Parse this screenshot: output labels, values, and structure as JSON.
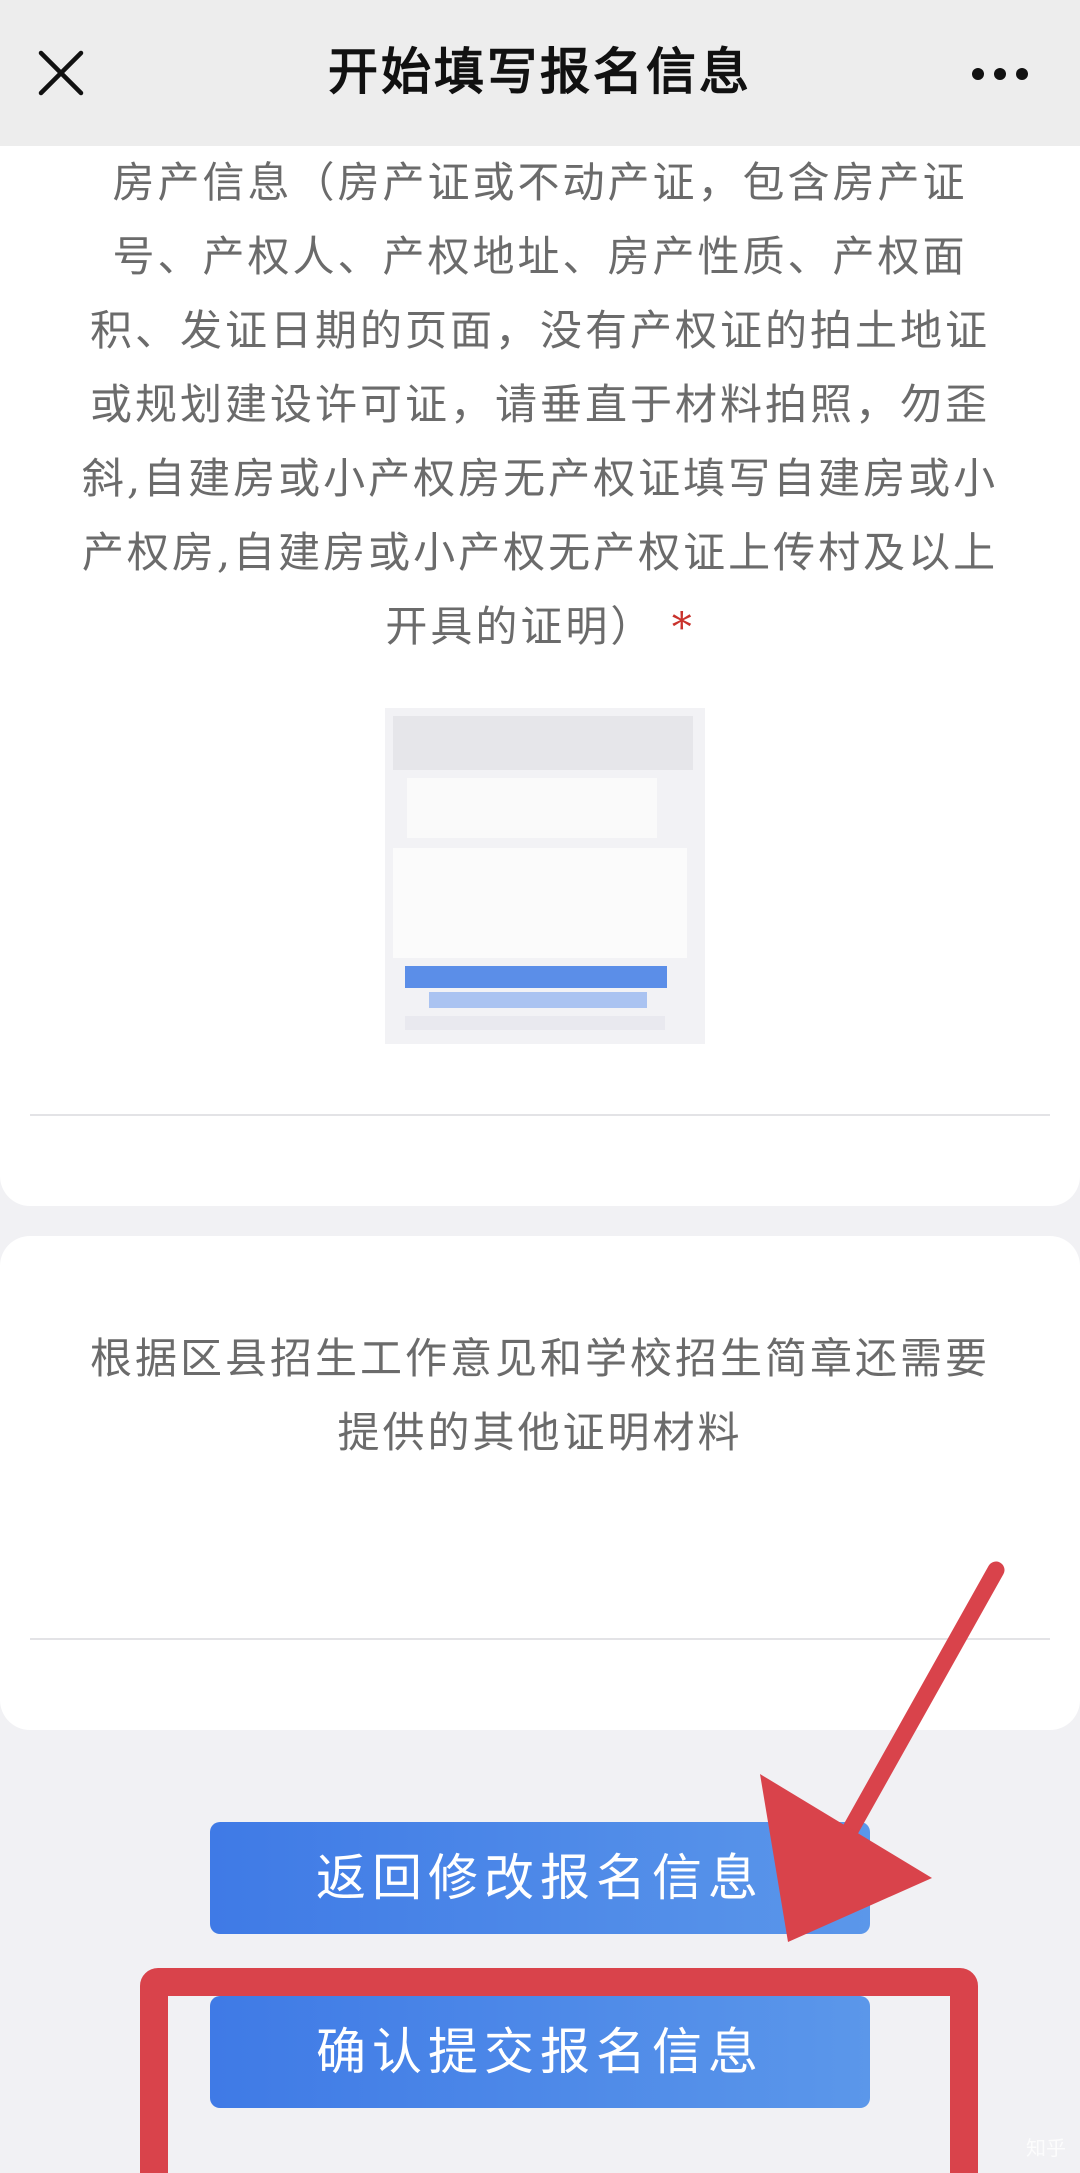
{
  "header": {
    "title": "开始填写报名信息",
    "close_icon": "close-icon",
    "more_icon": "more-dots-icon"
  },
  "property_section": {
    "description": "房产信息（房产证或不动产证，包含房产证号、产权人、产权地址、房产性质、产权面积、发证日期的页面，没有产权证的拍土地证或规划建设许可证，请垂直于材料拍照，勿歪斜,自建房或小产权房无产权证填写自建房或小产权房,自建房或小产权无产权证上传村及以上开具的证明）",
    "required_mark": "*",
    "required_color": "#c9322c"
  },
  "other_section": {
    "description": "根据区县招生工作意见和学校招生简章还需要提供的其他证明材料"
  },
  "buttons": {
    "back_label": "返回修改报名信息",
    "confirm_label": "确认提交报名信息",
    "color_start": "#3f7ae6",
    "color_end": "#5b97ea"
  },
  "annotation": {
    "color": "#d9434b",
    "arrow_icon": "red-arrow-icon"
  },
  "watermark": "知乎"
}
